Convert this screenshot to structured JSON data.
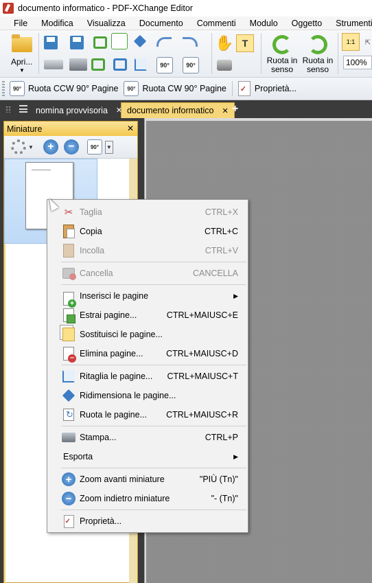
{
  "window": {
    "title": "documento informatico - PDF-XChange Editor"
  },
  "menubar": [
    "File",
    "Modifica",
    "Visualizza",
    "Documento",
    "Commenti",
    "Modulo",
    "Oggetto",
    "Strumenti"
  ],
  "toolbar": {
    "open_label": "Apri...",
    "rotate_ccw_label": "90°",
    "rotate_cw_label": "90°",
    "rotate_view_ccw_label": "Ruota in senso",
    "rotate_view_cw_label": "Ruota in senso",
    "zoom_value": "100%",
    "fit_label": "1:1"
  },
  "toolbar2": {
    "rotate_ccw": "Ruota CCW 90° Pagine",
    "rotate_cw": "Ruota CW 90° Pagine",
    "properties": "Proprietà...",
    "rot_icon_text": "90°"
  },
  "tabs": [
    {
      "label": "nomina provvisoria",
      "close": "✕"
    },
    {
      "label": "documento informatico",
      "close": "✕"
    }
  ],
  "panel": {
    "title": "Miniature",
    "close": "✕",
    "rot_icon_text": "90°"
  },
  "context_menu": {
    "items": [
      {
        "label": "Taglia",
        "shortcut": "CTRL+X",
        "disabled": true,
        "icon": "scissors-icon"
      },
      {
        "label": "Copia",
        "shortcut": "CTRL+C",
        "disabled": false,
        "icon": "copy-icon"
      },
      {
        "label": "Incolla",
        "shortcut": "CTRL+V",
        "disabled": true,
        "icon": "paste-icon"
      },
      {
        "label": "Cancella",
        "shortcut": "CANCELLA",
        "disabled": true,
        "icon": "delete-icon"
      },
      {
        "label": "Inserisci le pagine",
        "shortcut": "",
        "disabled": false,
        "icon": "insert-pages-icon",
        "submenu": true
      },
      {
        "label": "Estrai pagine...",
        "shortcut": "CTRL+MAIUSC+E",
        "disabled": false,
        "icon": "extract-pages-icon"
      },
      {
        "label": "Sostituisci le pagine...",
        "shortcut": "",
        "disabled": false,
        "icon": "replace-pages-icon"
      },
      {
        "label": "Elimina pagine...",
        "shortcut": "CTRL+MAIUSC+D",
        "disabled": false,
        "icon": "delete-pages-icon"
      },
      {
        "label": "Ritaglia le pagine...",
        "shortcut": "CTRL+MAIUSC+T",
        "disabled": false,
        "icon": "crop-pages-icon"
      },
      {
        "label": "Ridimensiona le pagine...",
        "shortcut": "",
        "disabled": false,
        "icon": "resize-pages-icon"
      },
      {
        "label": "Ruota le pagine...",
        "shortcut": "CTRL+MAIUSC+R",
        "disabled": false,
        "icon": "rotate-pages-icon"
      },
      {
        "label": "Stampa...",
        "shortcut": "CTRL+P",
        "disabled": false,
        "icon": "print-icon"
      },
      {
        "label": "Esporta",
        "shortcut": "",
        "disabled": false,
        "icon": "",
        "submenu": true
      },
      {
        "label": "Zoom avanti miniature",
        "shortcut": "\"PIÙ (Tn)\"",
        "disabled": false,
        "icon": "zoom-in-icon"
      },
      {
        "label": "Zoom indietro miniature",
        "shortcut": "\"- (Tn)\"",
        "disabled": false,
        "icon": "zoom-out-icon"
      },
      {
        "label": "Proprietà...",
        "shortcut": "",
        "disabled": false,
        "icon": "properties-icon"
      }
    ],
    "submenu_arrow": "▶"
  },
  "colors": {
    "active_tab": "#f6d67a",
    "panel_header": "#f2c84f",
    "thumbnail_selection": "#bfdaf7",
    "document_background": "#8b8b8b"
  }
}
